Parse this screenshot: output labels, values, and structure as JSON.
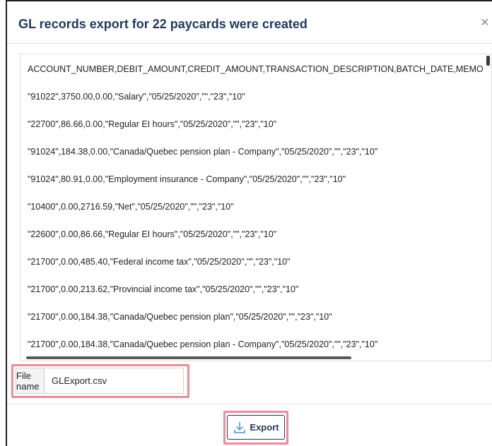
{
  "dialog": {
    "title": "GL records export for 22 paycards were created",
    "close_icon": "×"
  },
  "export_content": {
    "lines": [
      "ACCOUNT_NUMBER,DEBIT_AMOUNT,CREDIT_AMOUNT,TRANSACTION_DESCRIPTION,BATCH_DATE,MEMO",
      "\"91022\",3750.00,0.00,\"Salary\",\"05/25/2020\",\"\",\"23\",\"10\"",
      "\"22700\",86.66,0.00,\"Regular EI hours\",\"05/25/2020\",\"\",\"23\",\"10\"",
      "\"91024\",184.38,0.00,\"Canada/Quebec pension plan - Company\",\"05/25/2020\",\"\",\"23\",\"10\"",
      "\"91024\",80.91,0.00,\"Employment insurance - Company\",\"05/25/2020\",\"\",\"23\",\"10\"",
      "\"10400\",0.00,2716.59,\"Net\",\"05/25/2020\",\"\",\"23\",\"10\"",
      "\"22600\",0.00,86.66,\"Regular EI hours\",\"05/25/2020\",\"\",\"23\",\"10\"",
      "\"21700\",0.00,485.40,\"Federal income tax\",\"05/25/2020\",\"\",\"23\",\"10\"",
      "\"21700\",0.00,213.62,\"Provincial income tax\",\"05/25/2020\",\"\",\"23\",\"10\"",
      "\"21700\",0.00,184.38,\"Canada/Quebec pension plan\",\"05/25/2020\",\"\",\"23\",\"10\"",
      "\"21700\",0.00,184.38,\"Canada/Quebec pension plan - Company\",\"05/25/2020\",\"\",\"23\",\"10\""
    ]
  },
  "file_name": {
    "label": "File name",
    "value": "GLExport.csv"
  },
  "export_button": {
    "label": "Export",
    "icon": "download-icon"
  },
  "colors": {
    "title": "#1f3a5f",
    "highlight": "#f08a95",
    "button_border": "#1f3a5f"
  }
}
